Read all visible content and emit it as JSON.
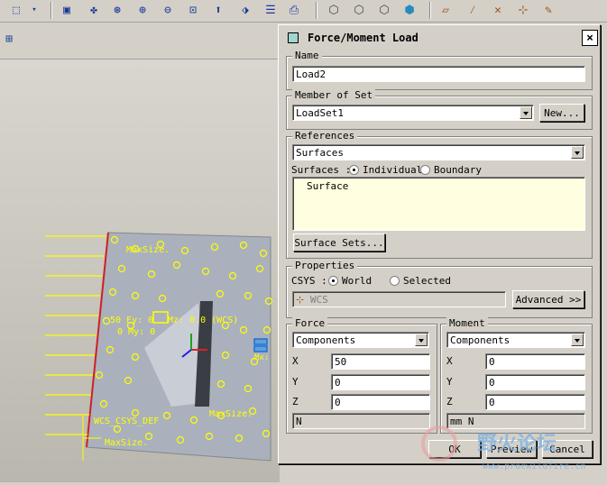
{
  "dialog": {
    "title": "Force/Moment Load",
    "close": "×",
    "name_group": "Name",
    "name_value": "Load2",
    "member_group": "Member of Set",
    "member_value": "LoadSet1",
    "new_button": "New...",
    "references_group": "References",
    "references_type": "Surfaces",
    "surfaces_label": "Surfaces :",
    "individual": "Individual",
    "boundary": "Boundary",
    "surface_item": "Surface",
    "surface_sets_button": "Surface Sets...",
    "properties_group": "Properties",
    "csys_label": "CSYS :",
    "world": "World",
    "selected": "Selected",
    "csys_value": "WCS",
    "advanced_button": "Advanced >>",
    "force": {
      "group": "Force",
      "mode": "Components",
      "x_label": "X",
      "x_value": "50",
      "y_label": "Y",
      "y_value": "0",
      "z_label": "Z",
      "z_value": "0",
      "units": "N"
    },
    "moment": {
      "group": "Moment",
      "mode": "Components",
      "x_label": "X",
      "x_value": "0",
      "y_label": "Y",
      "y_value": "0",
      "z_label": "Z",
      "z_value": "0",
      "units": "mm N"
    },
    "ok_button": "OK",
    "preview_button": "Preview",
    "cancel_button": "Cancel"
  },
  "viewport": {
    "annotation_maxsize_top": "MaxSize.",
    "annotation_force": "50 Fy: 0",
    "annotation_moment": "0 My: 0",
    "annotation_mz": "Mz: 0.0 (WCS)",
    "annotation_maxsize_right": "MaxSize.",
    "annotation_maxsize_bottom": "MaxSize.",
    "annotation_csys": "WCS_CSYS_DEF",
    "annotation_mx": "Mx:",
    "colors": {
      "model": "#a8b0bc",
      "load": "#ffff00",
      "edge": "#d02020"
    }
  },
  "watermark": {
    "brand": "野火论坛",
    "url": "www.proewildfire.cn"
  },
  "icons": [
    "select-box-icon",
    "view-icon",
    "datum-icon",
    "zoom-in-icon",
    "zoom-out-icon",
    "zoom-fit-icon",
    "orient-icon",
    "layer-icon",
    "saved-view-icon",
    "shade-icon",
    "wireframe-icon",
    "hidden-icon",
    "no-hidden-icon",
    "shaded-icon",
    "datum-plane-icon",
    "datum-axis-icon",
    "datum-point-icon",
    "csys-icon",
    "annotation-icon"
  ]
}
